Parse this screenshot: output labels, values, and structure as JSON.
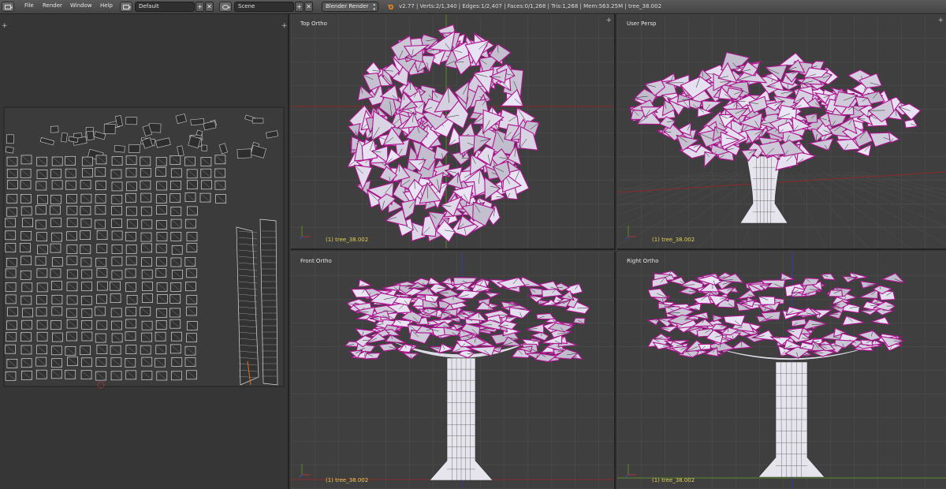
{
  "menu": {
    "file": "File",
    "render": "Render",
    "window": "Window",
    "help": "Help"
  },
  "screen_layout": {
    "value": "Default",
    "add": "+",
    "close": "✕"
  },
  "scene": {
    "value": "Scene",
    "add": "+",
    "close": "✕"
  },
  "render_engine": "Blender Render",
  "stats": "v2.77 | Verts:2/1,340 | Edges:1/2,407 | Faces:0/1,268 | Tris:1,268 | Mem:563.25M | tree_38.002",
  "viewports": {
    "top": {
      "label": "Top Ortho",
      "object": "(1) tree_38.002"
    },
    "persp": {
      "label": "User Persp",
      "object": "(1) tree_38.002"
    },
    "front": {
      "label": "Front Ortho",
      "object": "(1) tree_38.002"
    },
    "right": {
      "label": "Right Ortho",
      "object": "(1) tree_38.002"
    }
  },
  "colors": {
    "leaf_fill": "#d8d5e0",
    "leaf_edge": "#b0128f",
    "trunk": "#e6e4ec",
    "x_axis": "#8b2a2a",
    "y_axis": "#5a8a2a",
    "z_axis": "#3a3aa0",
    "object_label": "#e2ce54"
  }
}
